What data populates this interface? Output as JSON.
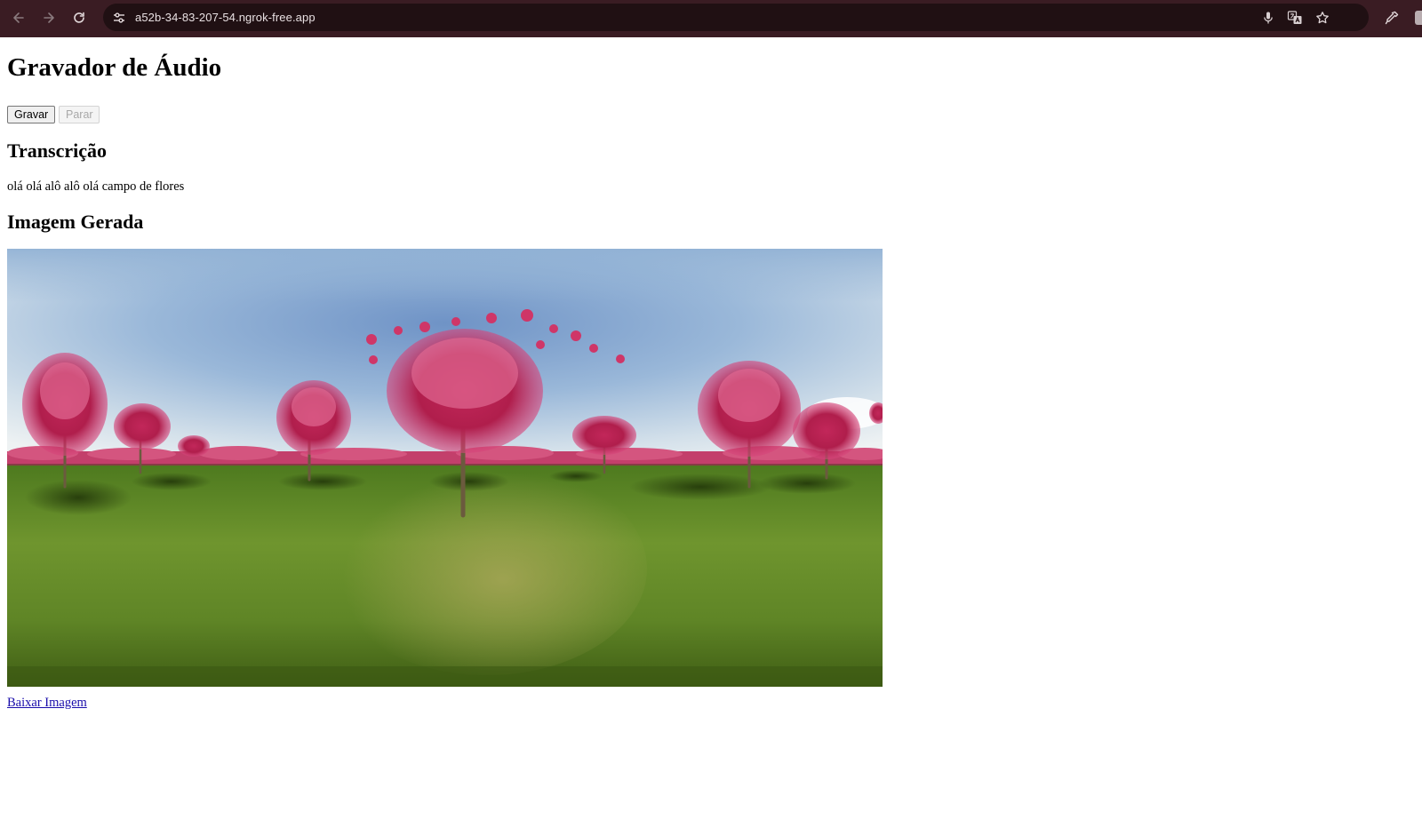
{
  "browser": {
    "url": "a52b-34-83-207-54.ngrok-free.app",
    "icons": {
      "back": "arrow-left-icon",
      "forward": "arrow-right-icon",
      "reload": "reload-icon",
      "site_info": "tune-icon",
      "mic": "microphone-icon",
      "translate": "translate-icon",
      "bookmark": "star-icon",
      "extension": "eyedropper-icon"
    },
    "colors": {
      "frame": "#3a1c23",
      "omnibox": "#201013"
    }
  },
  "page": {
    "title": "Gravador de Áudio",
    "buttons": {
      "record": "Gravar",
      "stop": "Parar"
    },
    "transcription": {
      "heading": "Transcrição",
      "text": "olá olá alô alô olá campo de flores"
    },
    "image": {
      "heading": "Imagem Gerada",
      "download_label": "Baixar Imagem",
      "link_color": "#1a0dab"
    }
  }
}
